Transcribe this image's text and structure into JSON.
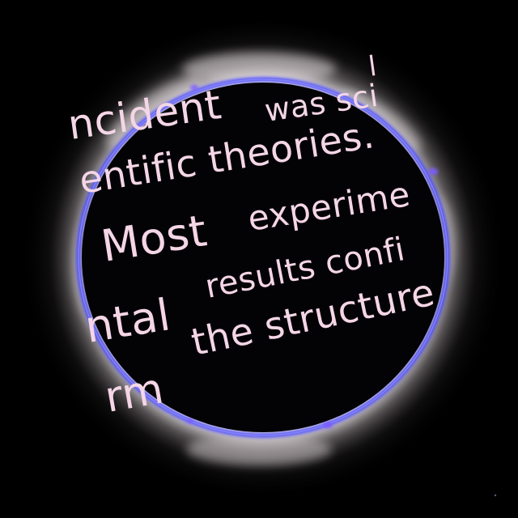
{
  "scene": {
    "description_subject": "total solar eclipse",
    "colors": {
      "background": "#000000",
      "moon_disk": "#030205",
      "corona_inner": "#ffffff",
      "corona_mid": "#cfc7c9",
      "limb": "#3d3cff",
      "prominence": "#7a5cff",
      "caption_text": "#f4d6e6"
    }
  },
  "caption": {
    "tick": "l",
    "line1a": "ncident",
    "line1b": "was sci",
    "line2a": "entific theories.",
    "line3a": "Most",
    "line3b": "experime",
    "line4a": "ntal",
    "line4b": "results confi",
    "line5a": "rm",
    "line5b": "the structure"
  }
}
